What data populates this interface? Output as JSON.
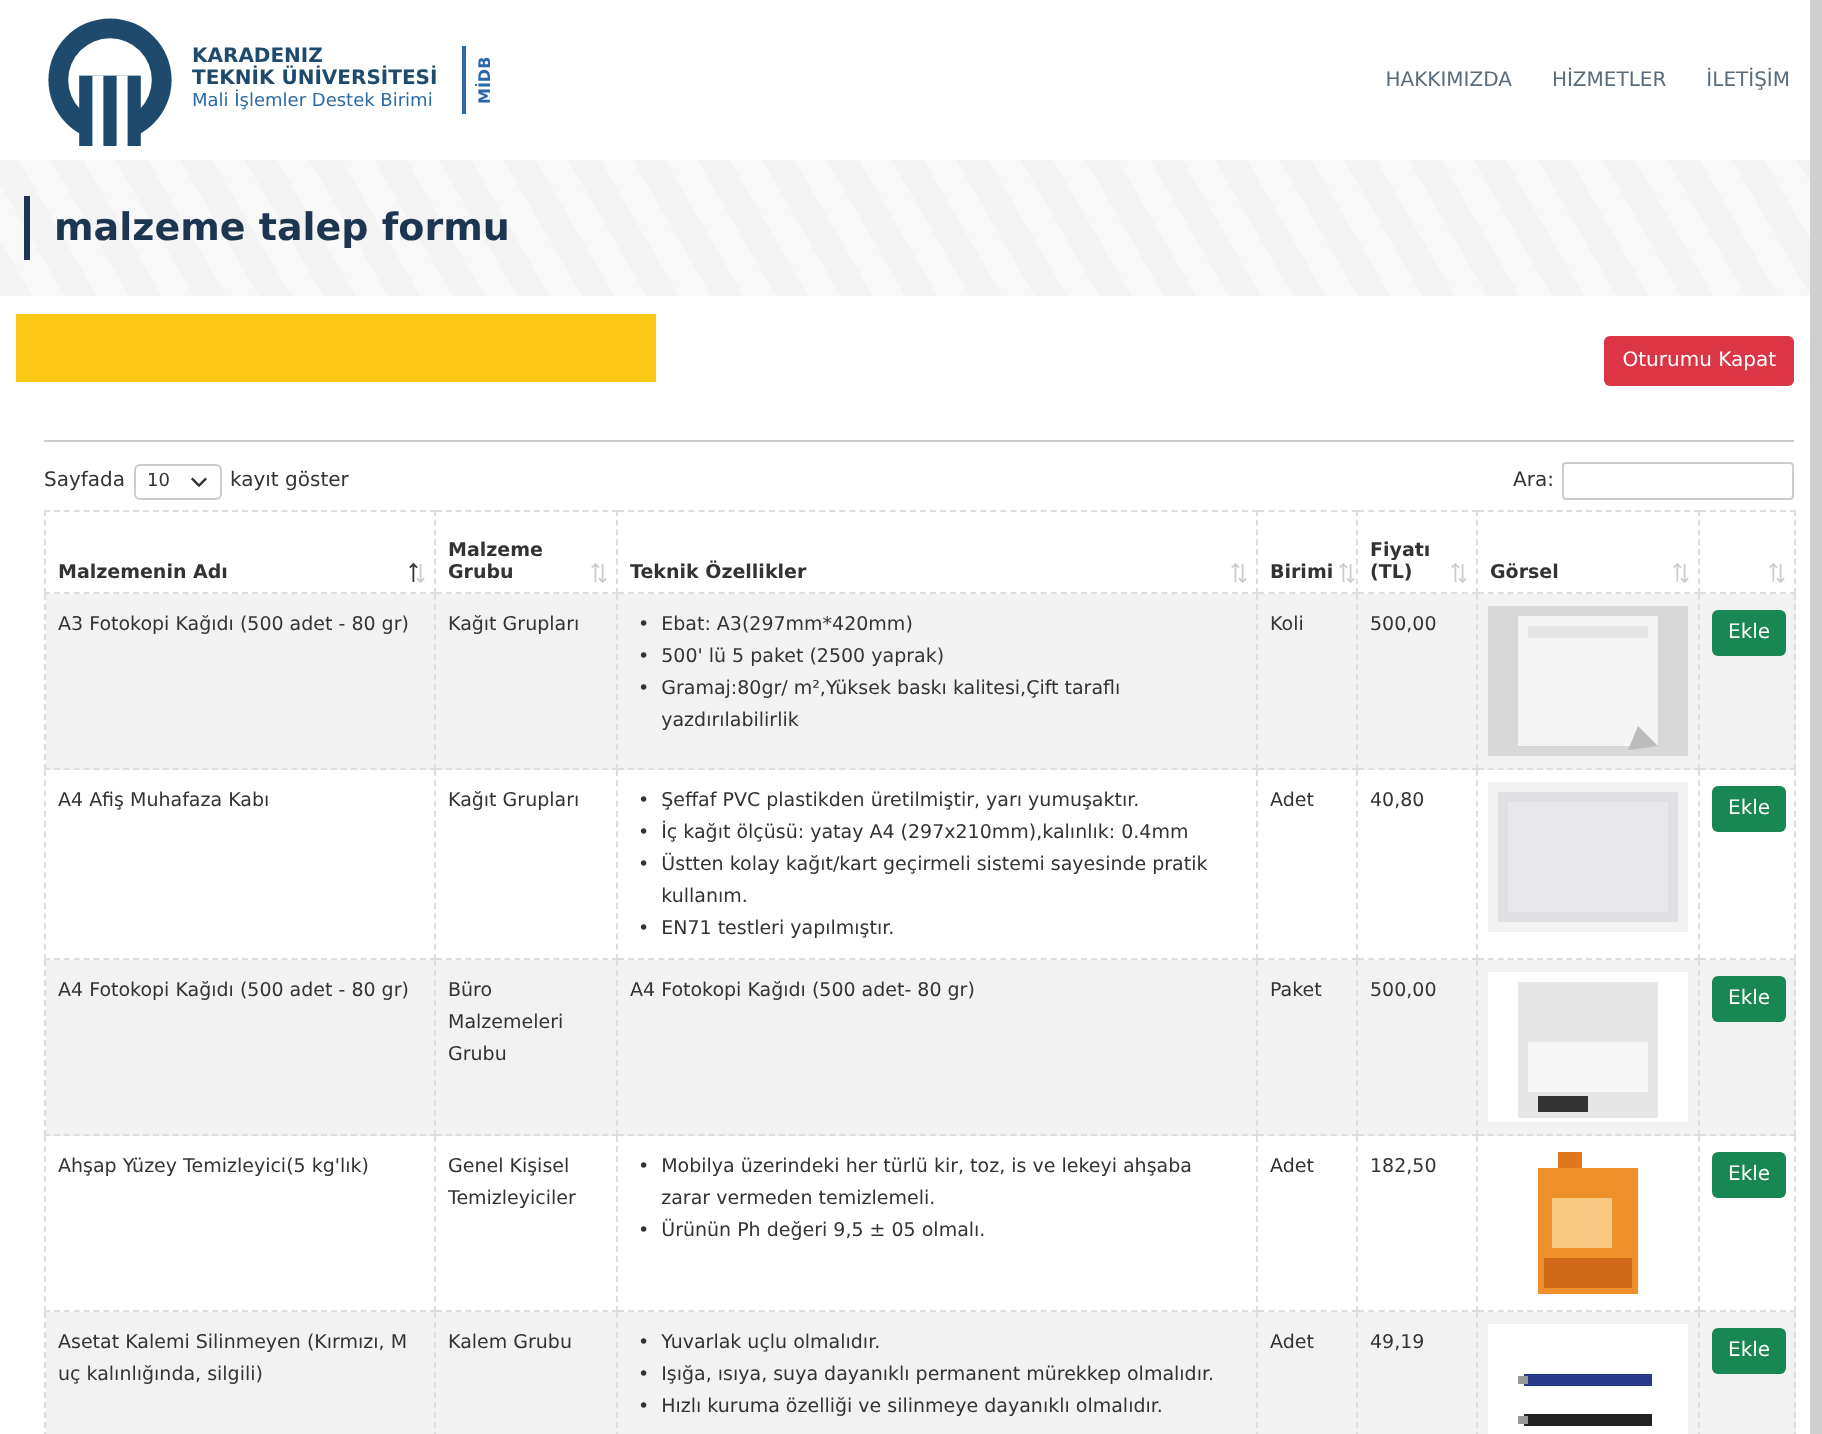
{
  "header": {
    "logo_lines": [
      "KARADENIZ",
      "TEKNİK ÜNİVERSİTESİ"
    ],
    "logo_subtitle": "Mali İşlemler Destek Birimi",
    "logo_tag": "MİDB",
    "nav": [
      {
        "label": "HAKKIMIZDA"
      },
      {
        "label": "HİZMETLER"
      },
      {
        "label": "İLETİŞİM"
      }
    ]
  },
  "page_title": "malzeme talep formu",
  "logout_button": "Oturumu Kapat",
  "length_control": {
    "prefix": "Sayfada",
    "value": "10",
    "suffix": "kayıt göster"
  },
  "search": {
    "label": "Ara:"
  },
  "table": {
    "columns": [
      {
        "label": "Malzemenin Adı",
        "sorted": true
      },
      {
        "label": "Malzeme Grubu",
        "sorted": false
      },
      {
        "label": "Teknik Özellikler",
        "sorted": false
      },
      {
        "label": "Birimi",
        "sorted": false
      },
      {
        "label": "Fiyatı (TL)",
        "sorted": false
      },
      {
        "label": "Görsel",
        "sorted": false
      },
      {
        "sorted": false
      }
    ],
    "bullet": "•",
    "rows": [
      {
        "name": "A3 Fotokopi Kağıdı (500 adet - 80 gr)",
        "group": "Kağıt Grupları",
        "specs": {
          "kind": "list",
          "items": [
            "Ebat: A3(297mm*420mm)",
            "500' lü 5 paket (2500 yaprak)",
            "Gramaj:80gr/ m²,Yüksek baskı kalitesi,Çift taraflı yazdırılabilirlik"
          ]
        },
        "unit": "Koli",
        "price": "500,00",
        "button": "Ekle"
      },
      {
        "name": "A4 Afiş Muhafaza Kabı",
        "group": "Kağıt Grupları",
        "specs": {
          "kind": "list",
          "items": [
            "Şeffaf PVC plastikden üretilmiştir, yarı yumuşaktır.",
            "İç kağıt ölçüsü: yatay A4 (297x210mm),kalınlık: 0.4mm",
            "Üstten kolay kağıt/kart geçirmeli sistemi sayesinde pratik kullanım.",
            "EN71 testleri yapılmıştır."
          ]
        },
        "unit": "Adet",
        "price": "40,80",
        "button": "Ekle"
      },
      {
        "name": "A4 Fotokopi Kağıdı (500 adet - 80 gr)",
        "group": "Büro Malzemeleri Grubu",
        "specs": {
          "kind": "text",
          "text": "A4 Fotokopi Kağıdı (500 adet- 80 gr)"
        },
        "unit": "Paket",
        "price": "500,00",
        "button": "Ekle"
      },
      {
        "name": "Ahşap Yüzey Temizleyici(5 kg'lık)",
        "group": "Genel Kişisel Temizleyiciler",
        "specs": {
          "kind": "list",
          "items": [
            "Mobilya üzerindeki her türlü kir, toz, is ve lekeyi ahşaba zarar vermeden temizlemeli.",
            "Ürünün Ph değeri 9,5 ± 05 olmalı."
          ]
        },
        "unit": "Adet",
        "price": "182,50",
        "button": "Ekle"
      },
      {
        "name": "Asetat Kalemi Silinmeyen (Kırmızı, M uç kalınlığında, silgili)",
        "group": "Kalem Grubu",
        "specs": {
          "kind": "list",
          "items": [
            "Yuvarlak uçlu olmalıdır.",
            "Işığa, ısıya, suya dayanıklı permanent mürekkep olmalıdır.",
            "Hızlı kuruma özelliği ve silinmeye dayanıklı olmalıdır."
          ]
        },
        "unit": "Adet",
        "price": "49,19",
        "button": "Ekle"
      }
    ]
  }
}
